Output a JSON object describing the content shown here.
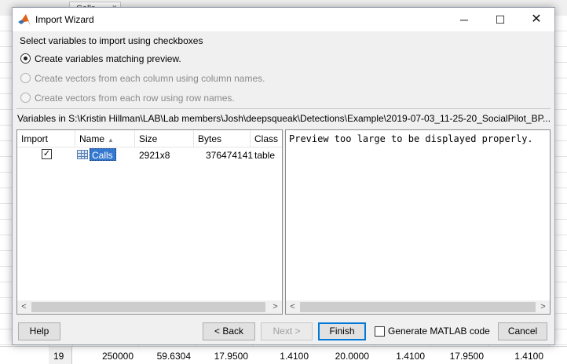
{
  "background": {
    "tab_label": "Calls",
    "tab_close": "×",
    "row": {
      "index": "19",
      "cells": [
        "250000",
        "59.6304",
        "17.9500",
        "1.4100",
        "20.0000",
        "1.4100",
        "17.9500",
        "1.4100"
      ]
    }
  },
  "dialog": {
    "title": "Import Wizard",
    "controls": {
      "minimize": "─",
      "maximize": "☐",
      "close": "✕"
    },
    "instruction": "Select variables to import using checkboxes",
    "options": [
      {
        "label": "Create variables matching preview.",
        "selected": true,
        "enabled": true
      },
      {
        "label": "Create vectors from each column using column names.",
        "selected": false,
        "enabled": false
      },
      {
        "label": "Create vectors from each row using row names.",
        "selected": false,
        "enabled": false
      }
    ],
    "variables_label": "Variables in S:\\Kristin Hillman\\LAB\\Lab members\\Josh\\deepsqueak\\Detections\\Example\\2019-07-03_11-25-20_SocialPilot_BP...",
    "table": {
      "headers": {
        "import": "Import",
        "name": "Name",
        "size": "Size",
        "bytes": "Bytes",
        "class": "Class"
      },
      "sort_indicator": "▲",
      "rows": [
        {
          "checked": true,
          "check_mark": "✓",
          "name": "Calls",
          "size": "2921x8",
          "bytes": "376474141",
          "class": "table"
        }
      ]
    },
    "preview_text": "Preview too large to be displayed properly.",
    "buttons": {
      "help": "Help",
      "back": "< Back",
      "next": "Next >",
      "finish": "Finish",
      "generate_code": "Generate MATLAB code",
      "cancel": "Cancel"
    },
    "scroll_arrows": {
      "left": "<",
      "right": ">"
    },
    "colors": {
      "selection": "#3478d0",
      "focus_border": "#0078d7",
      "dialog_bg": "#f0f0f0"
    }
  }
}
